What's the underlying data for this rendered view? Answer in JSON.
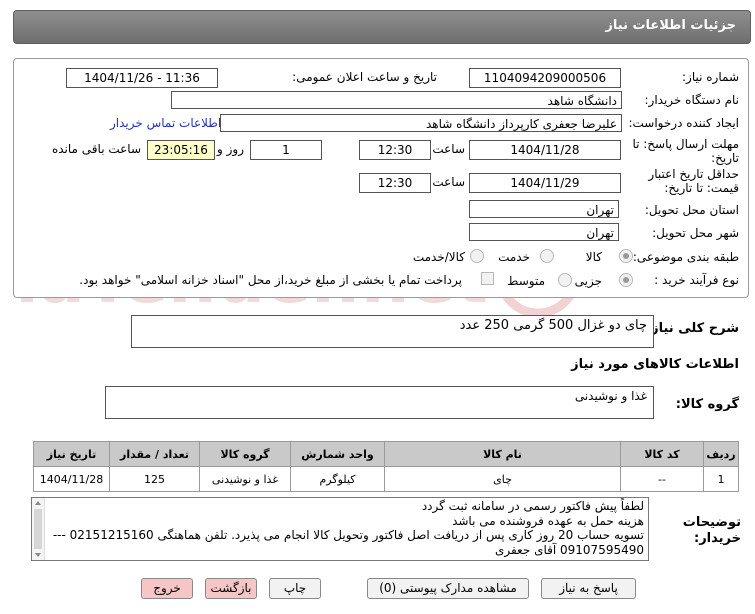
{
  "header": {
    "title": "جزئیات اطلاعات نیاز"
  },
  "fields": {
    "need_number_label": "شماره نیاز:",
    "need_number": "1104094209000506",
    "announce_label": "تاریخ و ساعت اعلان عمومی:",
    "announce_value": "1404/11/26 - 11:36",
    "buyer_org_label": "نام دستگاه خریدار:",
    "buyer_org": "دانشگاه شاهد",
    "requester_label": "ایجاد کننده درخواست:",
    "requester": "علیرضا جعفری کارپرداز دانشگاه شاهد",
    "contact_link": "اطلاعات تماس خریدار",
    "deadline_label_1": "مهلت ارسال پاسخ: تا",
    "deadline_label_2": "تاریخ:",
    "deadline_date": "1404/11/28",
    "hour_label": "ساعت",
    "deadline_time": "12:30",
    "days_value": "1",
    "days_label": "روز و",
    "remaining_time": "23:05:16",
    "remaining_label": "ساعت باقی مانده",
    "validity_label_1": "حداقل تاریخ اعتبار",
    "validity_label_2": "قیمت: تا تاریخ:",
    "validity_date": "1404/11/29",
    "validity_hour_label": "ساعت",
    "validity_time": "12:30",
    "province_label": "استان محل تحویل:",
    "province": "تهران",
    "city_label": "شهر محل تحویل:",
    "city": "تهران",
    "category_label": "طبقه بندی موضوعی:",
    "category_options": [
      "کالا",
      "خدمت",
      "کالا/خدمت"
    ],
    "purchase_type_label": "نوع فرآیند خرید :",
    "purchase_options": [
      "جزیی",
      "متوسط"
    ],
    "purchase_note": "پرداخت تمام یا بخشی از مبلغ خرید،از محل \"اسناد خزانه اسلامی\" خواهد بود."
  },
  "summary": {
    "label": "شرح کلی نیاز:",
    "value": "چای دو غزال 500 گرمی 250 عدد"
  },
  "goods_info_title": "اطلاعات کالاهای مورد نیاز",
  "goods_group": {
    "label": "گروه کالا:",
    "value": "غذا و نوشیدنی"
  },
  "table": {
    "headers": [
      "ردیف",
      "کد کالا",
      "نام کالا",
      "واحد شمارش",
      "گروه کالا",
      "تعداد / مقدار",
      "تاریخ نیاز"
    ],
    "rows": [
      [
        "1",
        "--",
        "چای",
        "کیلوگرم",
        "غذا و نوشیدنی",
        "125",
        "1404/11/28"
      ]
    ]
  },
  "buyer_notes": {
    "label_1": "توضیحات",
    "label_2": "خریدار:",
    "lines": [
      "لطفاً پیش فاکتور رسمی در سامانه ثبت گردد",
      "هزینه حمل به عهده فروشنده می باشد",
      "تسویه حساب 20 روز کاری پس از دریافت اصل فاکتور وتحویل کالا انجام می پذیرد. تلفن هماهنگی   02151215160 ---",
      "09107595490 آقای جعفری"
    ]
  },
  "buttons": {
    "reply": "پاسخ به نیاز",
    "docs": "مشاهده مدارک پیوستی (0)",
    "print": "چاپ",
    "back": "بازگشت",
    "exit": "خروج"
  },
  "watermark": {
    "text": "AriaTender.net"
  },
  "colors": {
    "title_bar": "#7d7d7d",
    "watermark": "#f1d3d3",
    "link": "#2233bb",
    "remaining_bg": "#ffffcc",
    "table_header": "#c9c9c9",
    "exit_button": "#f6c6c6"
  }
}
